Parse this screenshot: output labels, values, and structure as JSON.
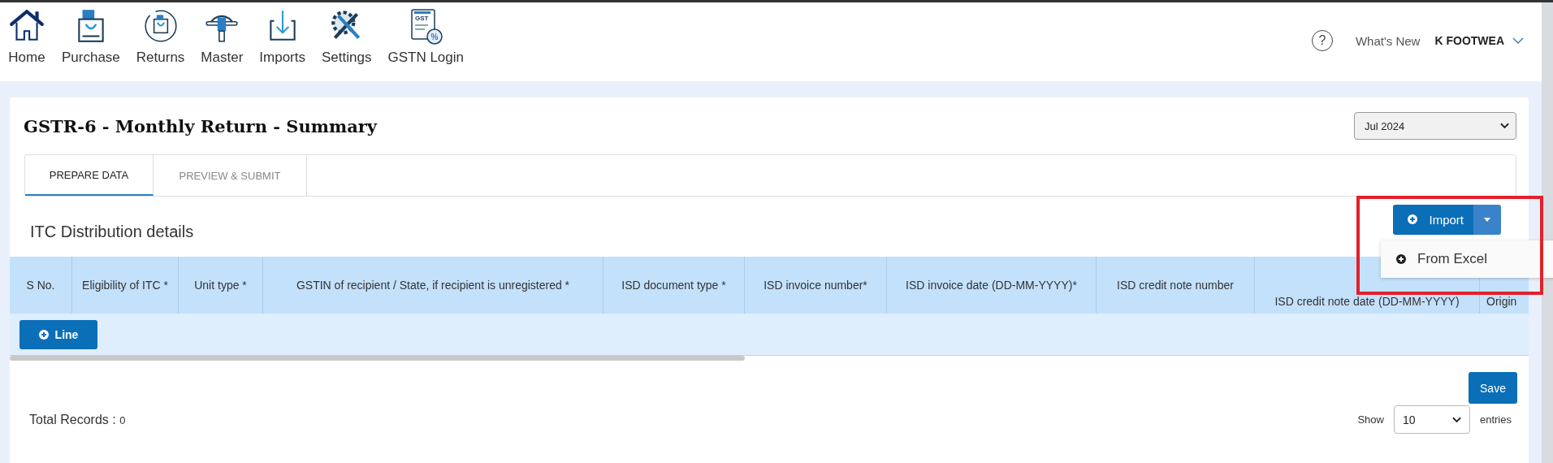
{
  "nav": [
    {
      "label": "Home",
      "kind": "home"
    },
    {
      "label": "Purchase",
      "kind": "bag"
    },
    {
      "label": "Returns",
      "kind": "returns"
    },
    {
      "label": "Master",
      "kind": "master"
    },
    {
      "label": "Imports",
      "kind": "download"
    },
    {
      "label": "Settings",
      "kind": "settings"
    },
    {
      "label": "GSTN Login",
      "kind": "gst",
      "badge": "GST",
      "symbol": "%"
    }
  ],
  "header": {
    "help": "?",
    "whats_new": "What's New",
    "company": "K FOOTWEA"
  },
  "title": "GSTR-6 - Monthly Return - Summary",
  "month": "Jul 2024",
  "tabs": [
    {
      "label": "PREPARE DATA",
      "selected": true
    },
    {
      "label": "PREVIEW & SUBMIT",
      "selected": false
    }
  ],
  "section": "ITC Distribution details",
  "import": {
    "label": "Import",
    "menu": [
      {
        "label": "From Excel"
      }
    ]
  },
  "table": {
    "columns": [
      "S No.",
      "Eligibility of ITC *",
      "Unit type *",
      "GSTIN of recipient / State, if recipient is unregistered *",
      "ISD document type *",
      "ISD invoice number*",
      "ISD invoice date (DD-MM-YYYY)*",
      "ISD credit note number",
      "ISD credit note date (DD-MM-YYYY)",
      "Origin"
    ],
    "add_line": "Line"
  },
  "save": "Save",
  "total_label": "Total Records :",
  "total": "0",
  "show": "Show",
  "page_size": "10",
  "entries": "entries"
}
